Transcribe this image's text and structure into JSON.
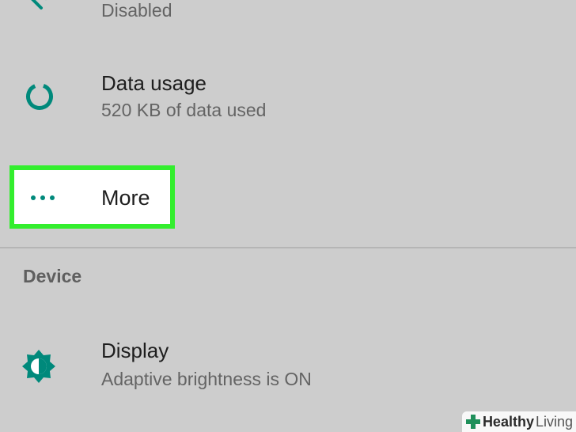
{
  "settings": {
    "top_item": {
      "subtitle": "Disabled"
    },
    "data_usage": {
      "title": "Data usage",
      "subtitle": "520 KB of data used"
    },
    "more": {
      "title": "More"
    },
    "device_section": {
      "header": "Device"
    },
    "display": {
      "title": "Display",
      "subtitle": "Adaptive brightness is ON"
    }
  },
  "watermark": {
    "brand_bold": "Healthy",
    "brand_light": "Living"
  },
  "colors": {
    "accent": "#00897b",
    "highlight": "#33ee2e",
    "background": "#cdcdcd"
  },
  "icons": {
    "top_item": "bluetooth-disabled-icon",
    "data_usage": "data-usage-icon",
    "more": "more-dots-icon",
    "display": "brightness-icon"
  }
}
